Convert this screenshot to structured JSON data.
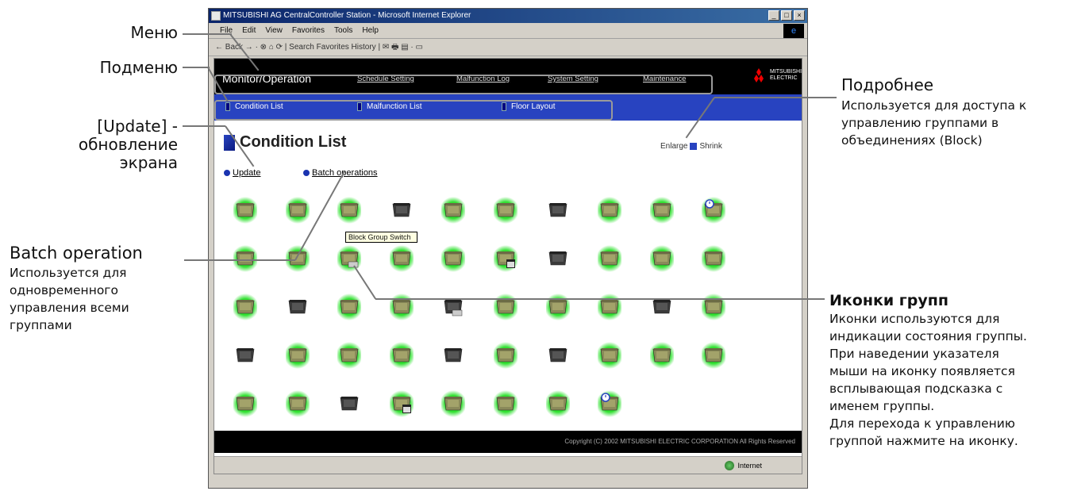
{
  "callouts": {
    "menu": "Меню",
    "submenu": "Подменю",
    "update_line1": "[Update] -",
    "update_line2": "обновление",
    "update_line3": "экрана",
    "batch_title": "Batch operation",
    "batch_desc": [
      "Используется для",
      "одновременного",
      "управления всеми",
      "группами"
    ],
    "details_title": "Подробнее",
    "details_desc": [
      "Используется для доступа к",
      "управлению группами в",
      "объединениях (Block)"
    ],
    "icons_title": "Иконки групп",
    "icons_desc": [
      "Иконки используются для",
      "индикации состояния группы.",
      "При наведении указателя",
      "мыши на иконку появляется",
      "всплывающая подсказка с",
      "именем группы.",
      "Для перехода к управлению",
      "группой нажмите на иконку."
    ]
  },
  "browser": {
    "title": "MITSUBISHI AG CentralController Station - Microsoft Internet Explorer",
    "menu": [
      "File",
      "Edit",
      "View",
      "Favorites",
      "Tools",
      "Help"
    ],
    "toolbar": "← Back  →  ·  ⊗  ⌂  ⟳  |  Search   Favorites   History  |  ✉  🖶  ▤  ·  ▭",
    "window_buttons": [
      "_",
      "□",
      "×"
    ],
    "status_zone": "Internet"
  },
  "app": {
    "main_nav": "Monitor/Operation",
    "nav_items": [
      "Schedule Setting",
      "Malfunction Log",
      "System Setting",
      "Maintenance"
    ],
    "logo_text": "MITSUBISHI ELECTRIC",
    "sub_nav": [
      "Condition List",
      "Malfunction List",
      "Floor Layout"
    ],
    "page_title": "Condition List",
    "legend_left": "Enlarge",
    "legend_right": "Shrink",
    "link_update": "Update",
    "link_batch": "Batch operations",
    "tooltip": "Block Group Switch",
    "footer": "Copyright (C) 2002 MITSUBISHI ELECTRIC CORPORATION All Rights Reserved"
  },
  "groups": [
    [
      "on",
      "on",
      "on",
      "off",
      "on",
      "on",
      "off",
      "on",
      "on",
      "on-timer"
    ],
    [
      "on",
      "on",
      "on-error",
      "on",
      "on",
      "on-schedule",
      "off",
      "on",
      "on",
      "on"
    ],
    [
      "on",
      "off",
      "on",
      "on",
      "off-error",
      "on",
      "on",
      "on",
      "off",
      "on"
    ],
    [
      "off",
      "on",
      "on",
      "on",
      "off",
      "on",
      "off",
      "on",
      "on",
      "on"
    ],
    [
      "on",
      "on",
      "off",
      "on-schedule",
      "on",
      "on",
      "on",
      "on-search"
    ]
  ],
  "colors": {
    "accent": "#2843c0",
    "on_glow": "#33ff33",
    "unit_on": "#8a8a5a",
    "unit_off": "#3a3a3a"
  }
}
